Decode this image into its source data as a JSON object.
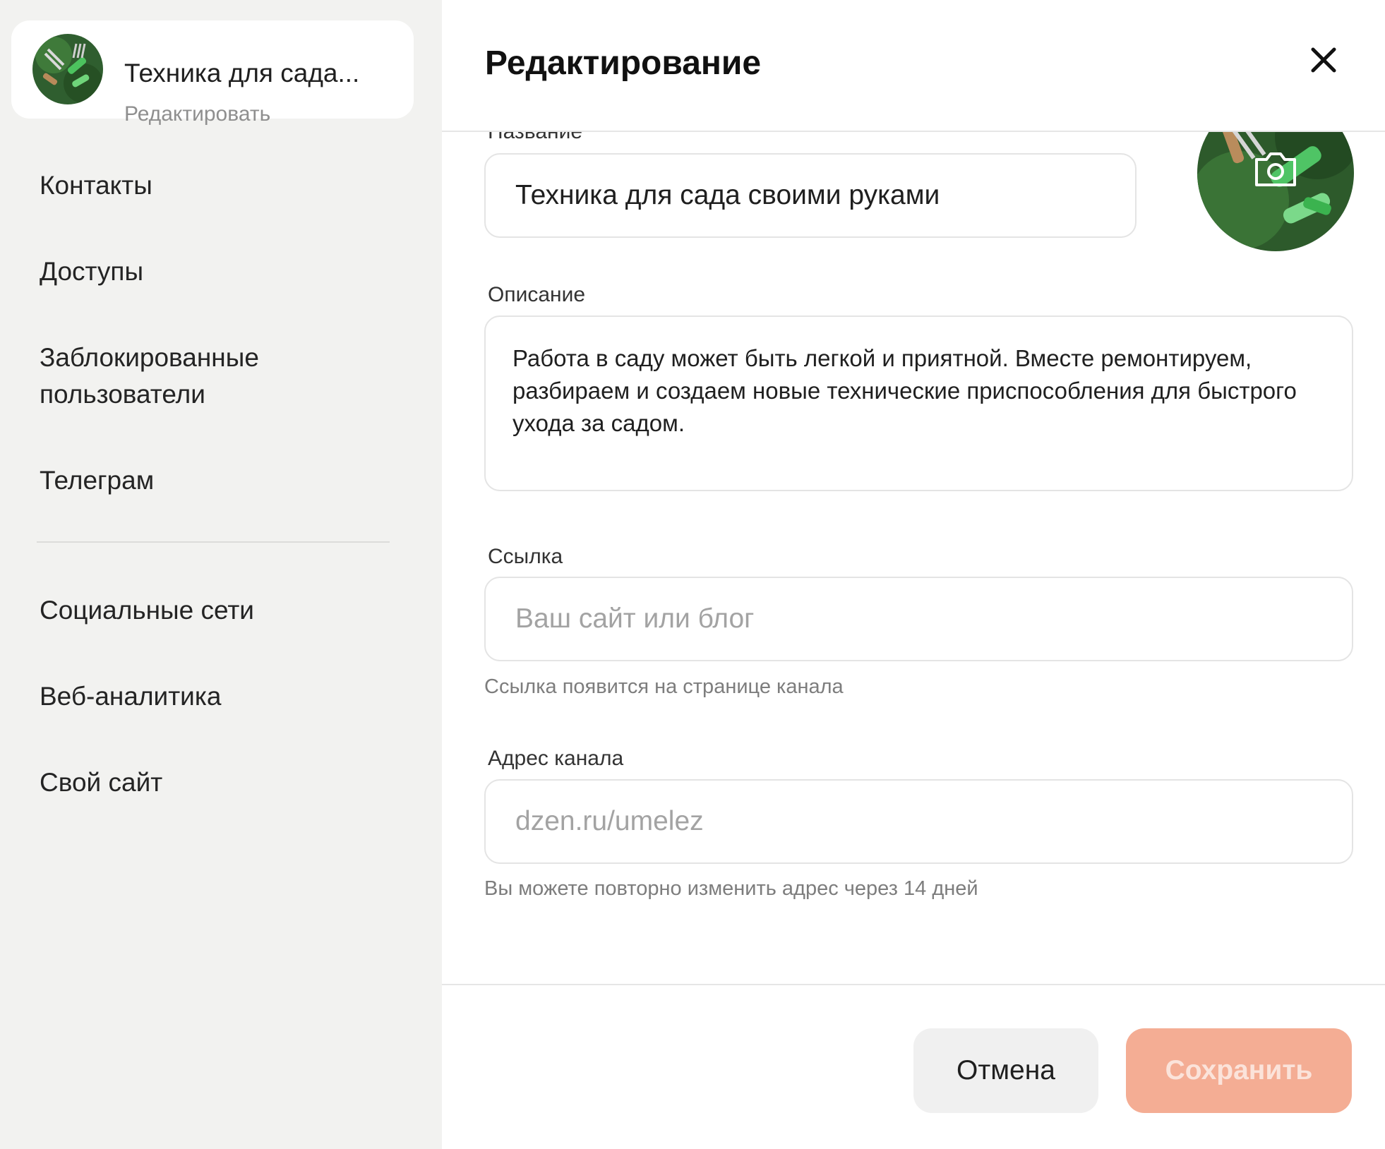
{
  "channel": {
    "name": "Техника для сада...",
    "edit_link": "Редактировать"
  },
  "sidebar": {
    "items": [
      {
        "label": "Контакты"
      },
      {
        "label": "Доступы"
      },
      {
        "label": "Заблокированные пользователи"
      },
      {
        "label": "Телеграм"
      },
      {
        "label": "Социальные сети"
      },
      {
        "label": "Веб-аналитика"
      },
      {
        "label": "Свой сайт"
      }
    ]
  },
  "modal": {
    "title": "Редактирование",
    "close_icon": "close-icon",
    "camera_icon": "camera-icon"
  },
  "form": {
    "name": {
      "label": "Название",
      "value": "Техника для сада своими руками"
    },
    "description": {
      "label": "Описание",
      "value": "Работа в саду может быть легкой и приятной. Вместе ремонтируем, разбираем и создаем новые технические приспособления для быстрого ухода за садом."
    },
    "link": {
      "label": "Ссылка",
      "placeholder": "Ваш сайт или блог",
      "hint": "Ссылка появится на странице канала"
    },
    "address": {
      "label": "Адрес канала",
      "placeholder": "dzen.ru/umelez",
      "hint": "Вы можете повторно изменить адрес через 14 дней"
    }
  },
  "buttons": {
    "cancel": "Отмена",
    "save": "Сохранить"
  },
  "colors": {
    "sidebar_bg": "#f2f2f0",
    "save_button_disabled": "#f4ad94",
    "avatar_green": "#2f6b3a"
  }
}
